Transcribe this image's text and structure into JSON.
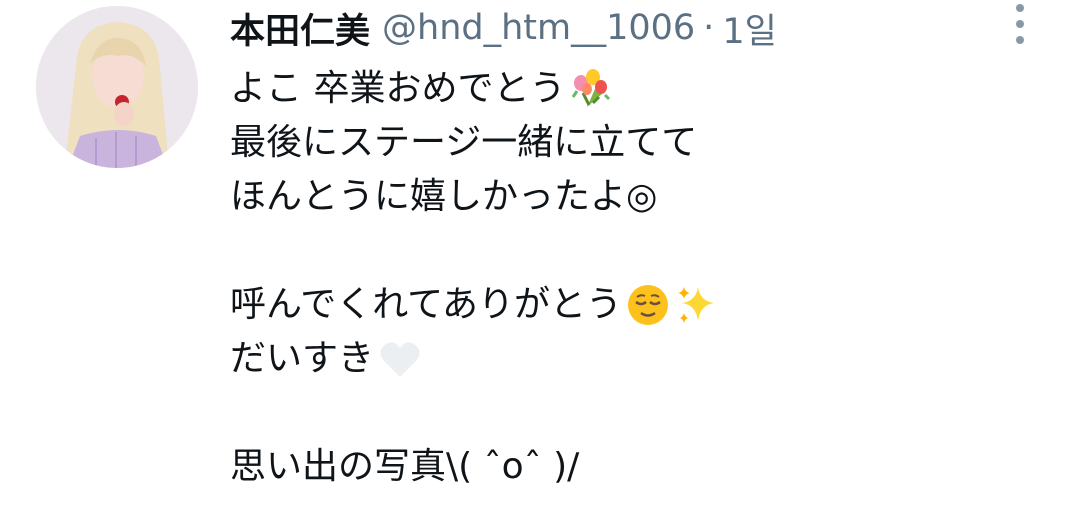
{
  "tweet": {
    "author": {
      "display_name": "本田仁美",
      "handle": "@hnd_htm__1006",
      "separator": "·",
      "time": "1일"
    },
    "lines": [
      {
        "text": "よこ 卒業おめでとう",
        "emoji": "bouquet-icon"
      },
      {
        "text": "最後にステージ一緒に立てて",
        "emoji": null
      },
      {
        "text": "ほんとうに嬉しかったよ◎",
        "emoji": null
      },
      {
        "text": "",
        "emoji": null
      },
      {
        "text": "呼んでくれてありがとう",
        "emoji": "relieved-face-icon,sparkles-icon"
      },
      {
        "text": "だいすき",
        "emoji": "white-heart-icon"
      },
      {
        "text": "",
        "emoji": null
      },
      {
        "text": "思い出の写真\\( ˆoˆ )/",
        "emoji": null
      }
    ]
  },
  "colors": {
    "text": "#0f1419",
    "secondary": "#5b7083",
    "more_icon": "#8899a6",
    "background": "#ffffff"
  }
}
